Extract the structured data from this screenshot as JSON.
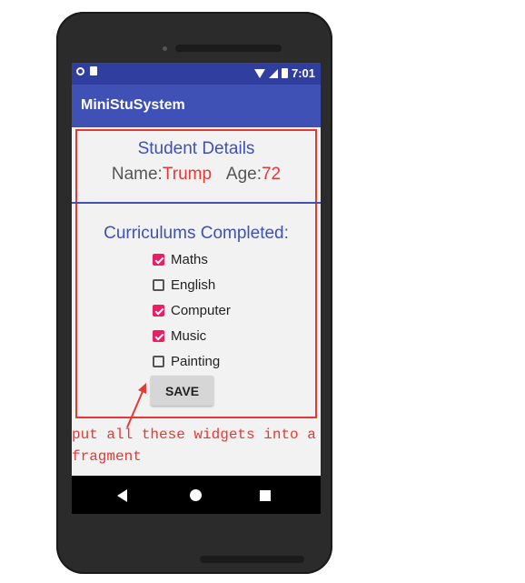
{
  "status_bar": {
    "time": "7:01"
  },
  "app": {
    "title": "MiniStuSystem"
  },
  "student": {
    "section_title": "Student Details",
    "name_label": "Name:",
    "name_value": "Trump",
    "age_label": "Age:",
    "age_value": "72"
  },
  "curriculums": {
    "title": "Curriculums Completed:",
    "items": [
      {
        "label": "Maths",
        "checked": true
      },
      {
        "label": "English",
        "checked": false
      },
      {
        "label": "Computer",
        "checked": true
      },
      {
        "label": "Music",
        "checked": true
      },
      {
        "label": "Painting",
        "checked": false
      }
    ]
  },
  "save_label": "SAVE",
  "annotation": {
    "line1": "put all these widgets into a",
    "line2": "fragment"
  },
  "colors": {
    "primary": "#3f51b5",
    "primary_dark": "#303f9f",
    "accent": "#e91e63",
    "annotation_red": "#e53935"
  }
}
